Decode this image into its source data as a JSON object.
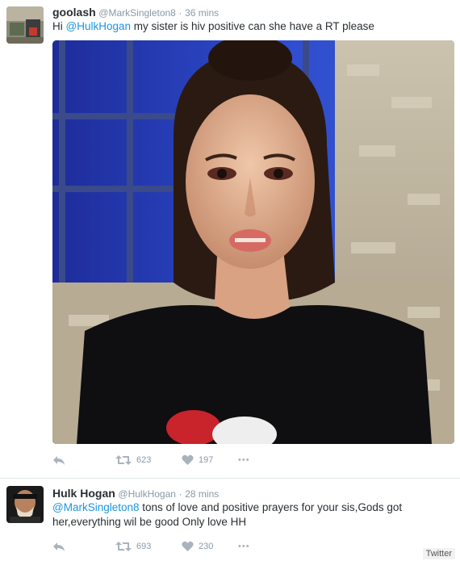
{
  "tweets": [
    {
      "name": "goolash",
      "handle": "@MarkSingleton8",
      "separator": "·",
      "time": "36 mins",
      "text_prefix": "Hi ",
      "mention": "@HulkHogan",
      "text_suffix": " my sister is hiv positive can she have a RT please",
      "retweets": "623",
      "likes": "197",
      "more": "•••"
    },
    {
      "name": "Hulk Hogan",
      "handle": "@HulkHogan",
      "separator": "·",
      "time": "28 mins",
      "mention": "@MarkSingleton8",
      "text_suffix": " tons of love and positive prayers for your sis,Gods got her,everything wil be good Only love HH",
      "retweets": "693",
      "likes": "230",
      "more": "•••"
    }
  ],
  "credit": "Twitter",
  "icons": [
    "reply-icon",
    "retweet-icon",
    "heart-icon",
    "more-icon"
  ],
  "colors": {
    "mention": "#1b95e0",
    "meta": "#8899a6",
    "text": "#292f33"
  }
}
